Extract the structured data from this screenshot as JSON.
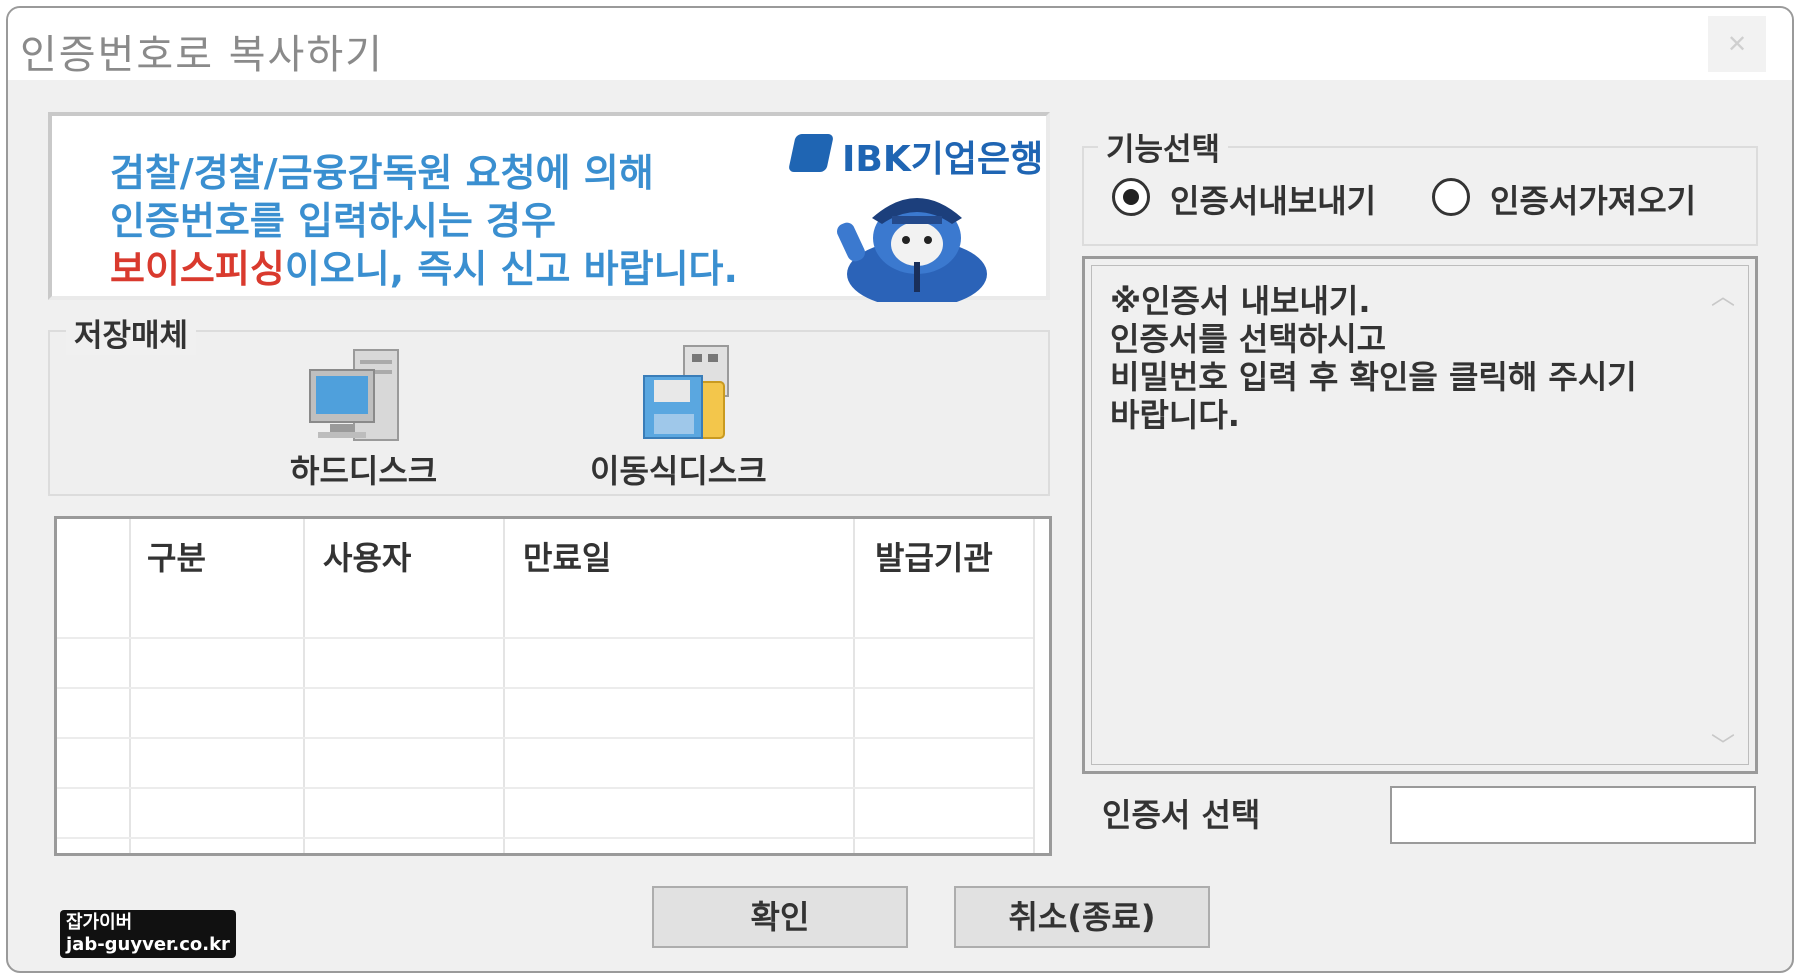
{
  "window": {
    "title": "인증번호로 복사하기",
    "close_glyph": "✕"
  },
  "banner": {
    "line1": "검찰/경찰/금융감독원 요청에 의해",
    "line2": "인증번호를 입력하시는 경우",
    "line3_red": "보이스피싱",
    "line3_rest": "이오니, 즉시 신고 바랍니다.",
    "brand": "IBK기업은행"
  },
  "storage": {
    "legend": "저장매체",
    "items": [
      {
        "label": "하드디스크",
        "icon": "computer-icon"
      },
      {
        "label": "이동식디스크",
        "icon": "removable-disk-icon"
      }
    ]
  },
  "table": {
    "columns": [
      "구분",
      "사용자",
      "만료일",
      "발급기관"
    ],
    "rows": []
  },
  "function": {
    "legend": "기능선택",
    "options": [
      {
        "label": "인증서내보내기",
        "selected": true
      },
      {
        "label": "인증서가져오기",
        "selected": false
      }
    ]
  },
  "description": {
    "lines": [
      "※인증서 내보내기.",
      "인증서를 선택하시고",
      "비밀번호 입력 후 확인을 클릭해 주시기",
      "바랍니다."
    ]
  },
  "cert_select": {
    "label": "인증서 선택",
    "value": ""
  },
  "buttons": {
    "ok": "확인",
    "cancel": "취소(종료)"
  },
  "watermark": {
    "line1": "잡가이버",
    "line2": "jab-guyver.co.kr"
  },
  "colors": {
    "banner_blue": "#3a8fd0",
    "banner_red": "#d93a2e",
    "ibk_blue": "#1f65b3"
  }
}
